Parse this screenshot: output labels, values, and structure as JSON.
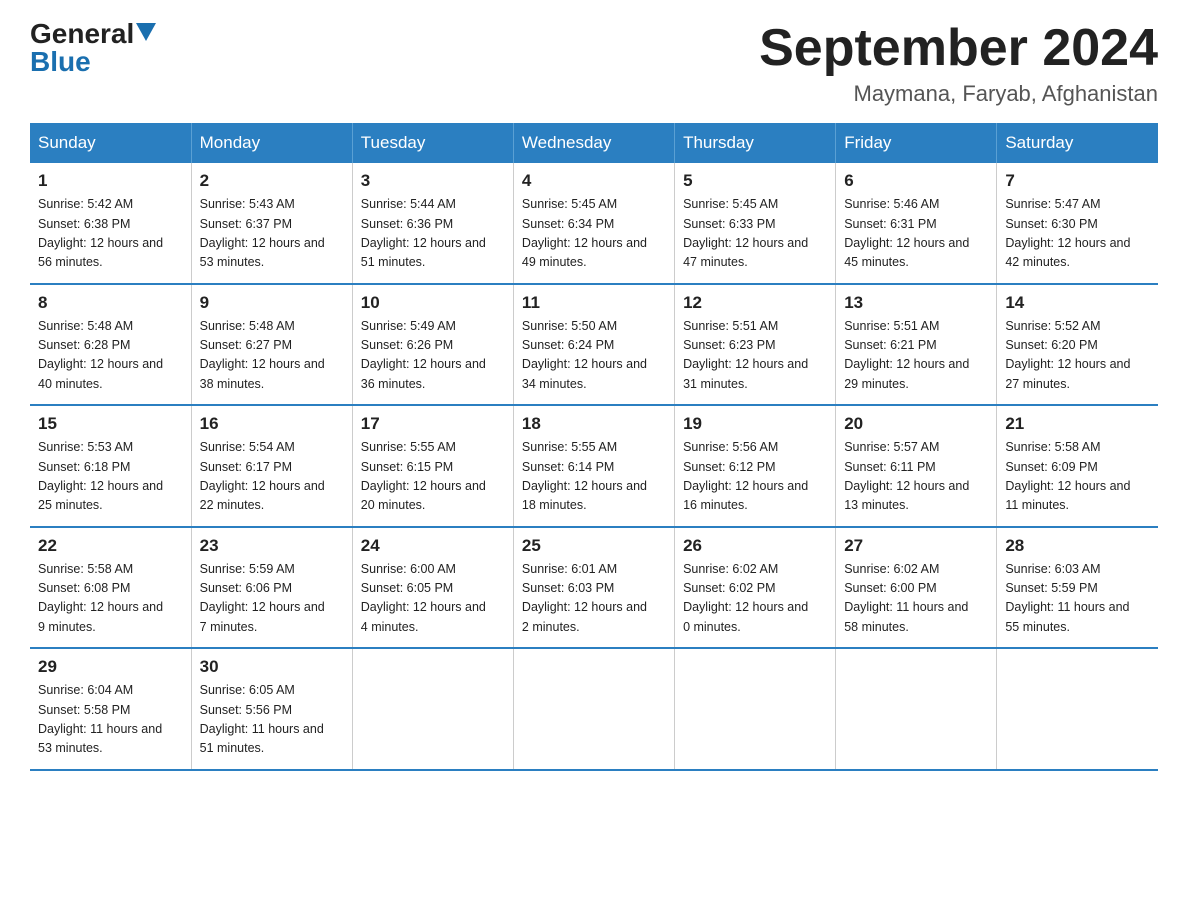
{
  "header": {
    "logo_general": "General",
    "logo_blue": "Blue",
    "title": "September 2024",
    "location": "Maymana, Faryab, Afghanistan"
  },
  "days_of_week": [
    "Sunday",
    "Monday",
    "Tuesday",
    "Wednesday",
    "Thursday",
    "Friday",
    "Saturday"
  ],
  "weeks": [
    [
      {
        "num": "1",
        "sunrise": "5:42 AM",
        "sunset": "6:38 PM",
        "daylight": "12 hours and 56 minutes."
      },
      {
        "num": "2",
        "sunrise": "5:43 AM",
        "sunset": "6:37 PM",
        "daylight": "12 hours and 53 minutes."
      },
      {
        "num": "3",
        "sunrise": "5:44 AM",
        "sunset": "6:36 PM",
        "daylight": "12 hours and 51 minutes."
      },
      {
        "num": "4",
        "sunrise": "5:45 AM",
        "sunset": "6:34 PM",
        "daylight": "12 hours and 49 minutes."
      },
      {
        "num": "5",
        "sunrise": "5:45 AM",
        "sunset": "6:33 PM",
        "daylight": "12 hours and 47 minutes."
      },
      {
        "num": "6",
        "sunrise": "5:46 AM",
        "sunset": "6:31 PM",
        "daylight": "12 hours and 45 minutes."
      },
      {
        "num": "7",
        "sunrise": "5:47 AM",
        "sunset": "6:30 PM",
        "daylight": "12 hours and 42 minutes."
      }
    ],
    [
      {
        "num": "8",
        "sunrise": "5:48 AM",
        "sunset": "6:28 PM",
        "daylight": "12 hours and 40 minutes."
      },
      {
        "num": "9",
        "sunrise": "5:48 AM",
        "sunset": "6:27 PM",
        "daylight": "12 hours and 38 minutes."
      },
      {
        "num": "10",
        "sunrise": "5:49 AM",
        "sunset": "6:26 PM",
        "daylight": "12 hours and 36 minutes."
      },
      {
        "num": "11",
        "sunrise": "5:50 AM",
        "sunset": "6:24 PM",
        "daylight": "12 hours and 34 minutes."
      },
      {
        "num": "12",
        "sunrise": "5:51 AM",
        "sunset": "6:23 PM",
        "daylight": "12 hours and 31 minutes."
      },
      {
        "num": "13",
        "sunrise": "5:51 AM",
        "sunset": "6:21 PM",
        "daylight": "12 hours and 29 minutes."
      },
      {
        "num": "14",
        "sunrise": "5:52 AM",
        "sunset": "6:20 PM",
        "daylight": "12 hours and 27 minutes."
      }
    ],
    [
      {
        "num": "15",
        "sunrise": "5:53 AM",
        "sunset": "6:18 PM",
        "daylight": "12 hours and 25 minutes."
      },
      {
        "num": "16",
        "sunrise": "5:54 AM",
        "sunset": "6:17 PM",
        "daylight": "12 hours and 22 minutes."
      },
      {
        "num": "17",
        "sunrise": "5:55 AM",
        "sunset": "6:15 PM",
        "daylight": "12 hours and 20 minutes."
      },
      {
        "num": "18",
        "sunrise": "5:55 AM",
        "sunset": "6:14 PM",
        "daylight": "12 hours and 18 minutes."
      },
      {
        "num": "19",
        "sunrise": "5:56 AM",
        "sunset": "6:12 PM",
        "daylight": "12 hours and 16 minutes."
      },
      {
        "num": "20",
        "sunrise": "5:57 AM",
        "sunset": "6:11 PM",
        "daylight": "12 hours and 13 minutes."
      },
      {
        "num": "21",
        "sunrise": "5:58 AM",
        "sunset": "6:09 PM",
        "daylight": "12 hours and 11 minutes."
      }
    ],
    [
      {
        "num": "22",
        "sunrise": "5:58 AM",
        "sunset": "6:08 PM",
        "daylight": "12 hours and 9 minutes."
      },
      {
        "num": "23",
        "sunrise": "5:59 AM",
        "sunset": "6:06 PM",
        "daylight": "12 hours and 7 minutes."
      },
      {
        "num": "24",
        "sunrise": "6:00 AM",
        "sunset": "6:05 PM",
        "daylight": "12 hours and 4 minutes."
      },
      {
        "num": "25",
        "sunrise": "6:01 AM",
        "sunset": "6:03 PM",
        "daylight": "12 hours and 2 minutes."
      },
      {
        "num": "26",
        "sunrise": "6:02 AM",
        "sunset": "6:02 PM",
        "daylight": "12 hours and 0 minutes."
      },
      {
        "num": "27",
        "sunrise": "6:02 AM",
        "sunset": "6:00 PM",
        "daylight": "11 hours and 58 minutes."
      },
      {
        "num": "28",
        "sunrise": "6:03 AM",
        "sunset": "5:59 PM",
        "daylight": "11 hours and 55 minutes."
      }
    ],
    [
      {
        "num": "29",
        "sunrise": "6:04 AM",
        "sunset": "5:58 PM",
        "daylight": "11 hours and 53 minutes."
      },
      {
        "num": "30",
        "sunrise": "6:05 AM",
        "sunset": "5:56 PM",
        "daylight": "11 hours and 51 minutes."
      },
      {
        "num": "",
        "sunrise": "",
        "sunset": "",
        "daylight": ""
      },
      {
        "num": "",
        "sunrise": "",
        "sunset": "",
        "daylight": ""
      },
      {
        "num": "",
        "sunrise": "",
        "sunset": "",
        "daylight": ""
      },
      {
        "num": "",
        "sunrise": "",
        "sunset": "",
        "daylight": ""
      },
      {
        "num": "",
        "sunrise": "",
        "sunset": "",
        "daylight": ""
      }
    ]
  ]
}
